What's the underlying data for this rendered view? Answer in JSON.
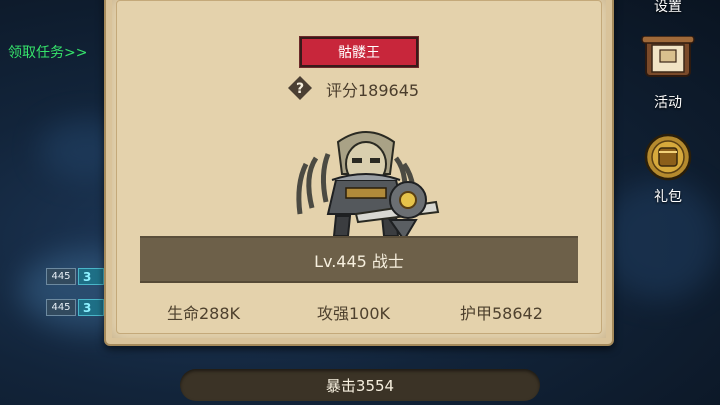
{
  "left_hud": {
    "task_link": "领取任务>>",
    "units": [
      {
        "level": "445",
        "num": "3"
      },
      {
        "level": "445",
        "num": "3"
      }
    ]
  },
  "right_menu": {
    "items": [
      {
        "label": "设置",
        "icon": "gear-icon"
      },
      {
        "label": "活动",
        "icon": "scroll-icon"
      },
      {
        "label": "礼包",
        "icon": "giftbag-icon"
      }
    ]
  },
  "boss_panel": {
    "name": "骷髅王",
    "score": "评分189645",
    "level_line": "Lv.445 战士",
    "stats": {
      "hp": "生命288K",
      "attack": "攻强100K",
      "armor": "护甲58642",
      "crit": "暴击3554"
    }
  },
  "colors": {
    "panel": "#e9d8b4",
    "name_tag": "#c8263b",
    "level_band": "#6d6049",
    "task_link": "#36e36b"
  }
}
